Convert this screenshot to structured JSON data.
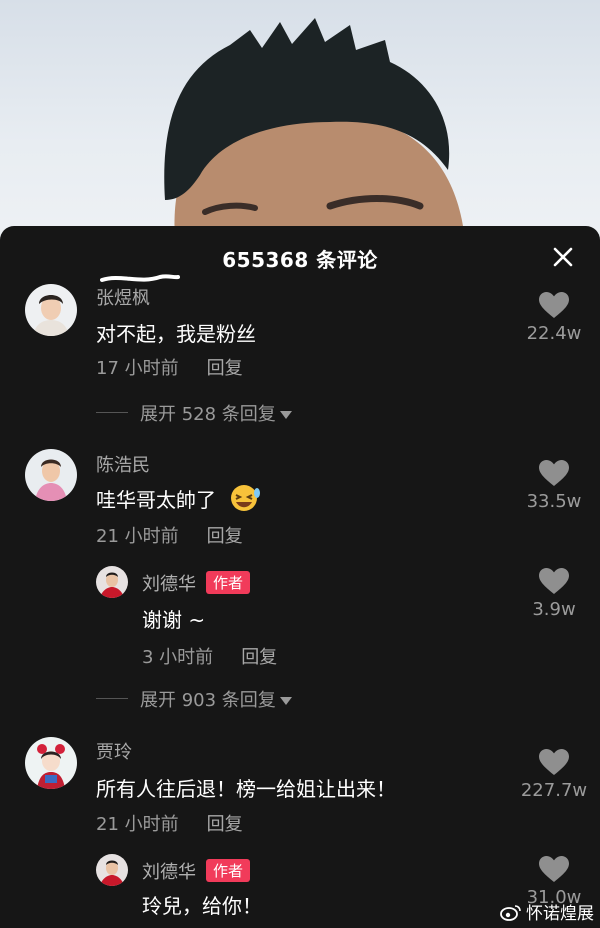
{
  "header": {
    "title": "655368 条评论"
  },
  "comments": [
    {
      "username": "张煜枫",
      "text": "对不起，我是粉丝",
      "time": "17 小时前",
      "reply": "回复",
      "likes": "22.4w",
      "expand": "展开 528 条回复"
    },
    {
      "username": "陈浩民",
      "text": "哇华哥太帥了",
      "time": "21 小时前",
      "reply": "回复",
      "likes": "33.5w",
      "emoji": "laughing-emoji",
      "sub": {
        "username": "刘德华",
        "badge": "作者",
        "text": "谢谢 ~",
        "time": "3 小时前",
        "reply": "回复",
        "likes": "3.9w"
      },
      "expand": "展开 903 条回复"
    },
    {
      "username": "贾玲",
      "text": "所有人往后退！榜一给姐让出来！",
      "time": "21 小时前",
      "reply": "回复",
      "likes": "227.7w",
      "sub": {
        "username": "刘德华",
        "badge": "作者",
        "text": "玲兒，给你！",
        "likes": "31.0w"
      }
    }
  ],
  "watermark": "怀诺煌展",
  "colors": {
    "sheet": "#161616",
    "badge": "#f13b5a",
    "muted": "#9a9a9a"
  }
}
